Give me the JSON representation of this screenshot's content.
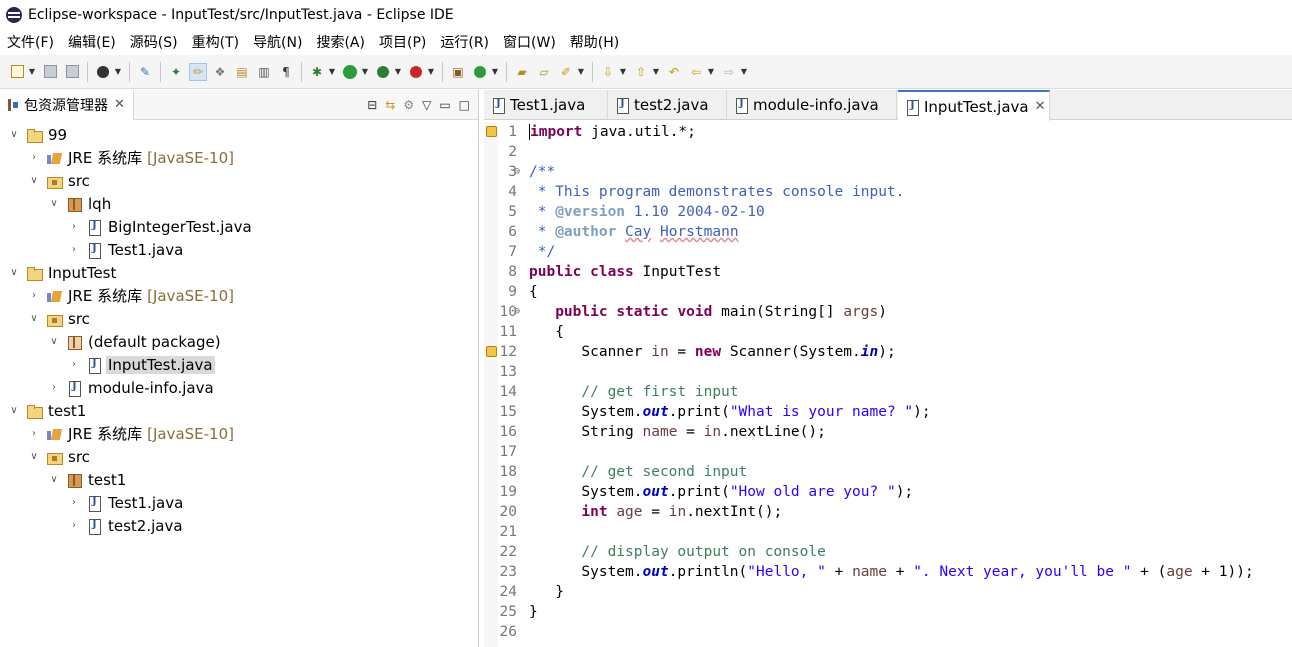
{
  "window": {
    "title": "Eclipse-workspace - InputTest/src/InputTest.java - Eclipse IDE"
  },
  "menu": [
    "文件(F)",
    "编辑(E)",
    "源码(S)",
    "重构(T)",
    "导航(N)",
    "搜索(A)",
    "项目(P)",
    "运行(R)",
    "窗口(W)",
    "帮助(H)"
  ],
  "explorer": {
    "title": "包资源管理器",
    "close": "✕",
    "tree": [
      {
        "label": "99",
        "deco": ""
      },
      {
        "label": "JRE 系统库",
        "deco": "[JavaSE-10]"
      },
      {
        "label": "src",
        "deco": ""
      },
      {
        "label": "lqh",
        "deco": ""
      },
      {
        "label": "BigIntegerTest.java",
        "deco": ""
      },
      {
        "label": "Test1.java",
        "deco": ""
      },
      {
        "label": "InputTest",
        "deco": ""
      },
      {
        "label": "JRE 系统库",
        "deco": "[JavaSE-10]"
      },
      {
        "label": "src",
        "deco": ""
      },
      {
        "label": "(default package)",
        "deco": ""
      },
      {
        "label": "InputTest.java",
        "deco": ""
      },
      {
        "label": "module-info.java",
        "deco": ""
      },
      {
        "label": "test1",
        "deco": ""
      },
      {
        "label": "JRE 系统库",
        "deco": "[JavaSE-10]"
      },
      {
        "label": "src",
        "deco": ""
      },
      {
        "label": "test1",
        "deco": ""
      },
      {
        "label": "Test1.java",
        "deco": ""
      },
      {
        "label": "test2.java",
        "deco": ""
      }
    ]
  },
  "editor": {
    "tabs": [
      "Test1.java",
      "test2.java",
      "module-info.java",
      "InputTest.java"
    ],
    "active_tab": "InputTest.java",
    "tab_close": "✕",
    "line_numbers": [
      "1",
      "2",
      "3",
      "4",
      "5",
      "6",
      "7",
      "8",
      "9",
      "10",
      "11",
      "12",
      "13",
      "14",
      "15",
      "16",
      "17",
      "18",
      "19",
      "20",
      "21",
      "22",
      "23",
      "24",
      "25",
      "26"
    ],
    "code": {
      "l1": {
        "kw": "import",
        "rest": " java.util.*;"
      },
      "l3": "/**",
      "l4": " * This program demonstrates console input.",
      "l5": {
        "pre": " * ",
        "tag": "@version",
        "rest": " 1.10 2004-02-10"
      },
      "l6": {
        "pre": " * ",
        "tag": "@author",
        "sp": " ",
        "w1": "Cay",
        "sp2": " ",
        "w2": "Horstmann"
      },
      "l7": " */",
      "l8": {
        "kw1": "public",
        "sp": " ",
        "kw2": "class",
        "rest": " InputTest"
      },
      "l9": "{",
      "l10": {
        "ind": "   ",
        "kw1": "public",
        "sp1": " ",
        "kw2": "static",
        "sp2": " ",
        "kw3": "void",
        "rest": " main(String[] ",
        "var": "args",
        "end": ")"
      },
      "l11": "   {",
      "l12": {
        "pre": "      Scanner ",
        "var": "in",
        "mid": " = ",
        "kw": "new",
        "mid2": " Scanner(System.",
        "fld": "in",
        "end": ");"
      },
      "l14": "      // get first input",
      "l15": {
        "pre": "      System.",
        "fld": "out",
        "mid": ".print(",
        "str": "\"What is your name? \"",
        "end": ");"
      },
      "l16": {
        "pre": "      String ",
        "var": "name",
        "mid": " = ",
        "var2": "in",
        "end": ".nextLine();"
      },
      "l18": "      // get second input",
      "l19": {
        "pre": "      System.",
        "fld": "out",
        "mid": ".print(",
        "str": "\"How old are you? \"",
        "end": ");"
      },
      "l20": {
        "ind": "      ",
        "kw": "int",
        "sp": " ",
        "var": "age",
        "mid": " = ",
        "var2": "in",
        "end": ".nextInt();"
      },
      "l22": "      // display output on console",
      "l23": {
        "pre": "      System.",
        "fld": "out",
        "mid": ".println(",
        "str1": "\"Hello, \"",
        "p1": " + ",
        "var1": "name",
        "p2": " + ",
        "str2": "\". Next year, you'll be \"",
        "p3": " + (",
        "var2": "age",
        "end": " + 1));"
      },
      "l24": "   }",
      "l25": "}"
    }
  },
  "colors": {
    "accent": "#3d73c5",
    "keyword": "#7f0055",
    "comment": "#3f7f5f",
    "javadoc": "#3f5fbf",
    "string": "#2a00ff"
  }
}
